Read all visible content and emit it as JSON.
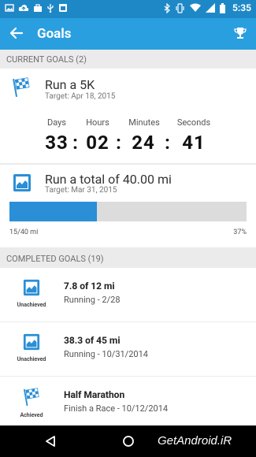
{
  "status_bar": {
    "time": "5:35",
    "left_icons": [
      "image-icon",
      "cloud-upload-icon",
      "bag-icon",
      "usb-icon",
      "clipboard-icon"
    ],
    "right_icons": [
      "bluetooth-icon",
      "vibrate-icon",
      "wifi-icon",
      "signal-icon",
      "battery-icon"
    ]
  },
  "app_bar": {
    "title": "Goals",
    "color": "#2a9fe0"
  },
  "current_goals": {
    "header": "CURRENT GOALS (2)",
    "goals": [
      {
        "title": "Run a 5K",
        "target": "Target: Apr 18, 2015",
        "icon": "checkered-flag-icon",
        "countdown": {
          "labels": [
            "Days",
            "Hours",
            "Minutes",
            "Seconds"
          ],
          "values": [
            "33",
            "02",
            "24",
            "41"
          ],
          "separator": ":"
        }
      },
      {
        "title": "Run a total of 40.00 mi",
        "target": "Target: Mar 31, 2015",
        "icon": "chart-icon",
        "progress": {
          "fraction": 0.37,
          "left_label": "15/40 mi",
          "right_label": "37%"
        }
      }
    ]
  },
  "completed_goals": {
    "header": "COMPLETED GOALS (19)",
    "items": [
      {
        "badge": "Unachieved",
        "icon": "chart-icon",
        "title": "7.8 of 12 mi",
        "subtitle": "Running - 2/28"
      },
      {
        "badge": "Unachieved",
        "icon": "chart-icon",
        "title": "38.3 of 45 mi",
        "subtitle": "Running - 10/31/2014"
      },
      {
        "badge": "Achieved",
        "icon": "checkered-flag-icon",
        "title": "Half Marathon",
        "subtitle": "Finish a Race - 10/12/2014"
      }
    ]
  },
  "nav_bar": {
    "watermark": "GetAndroid.iR"
  }
}
